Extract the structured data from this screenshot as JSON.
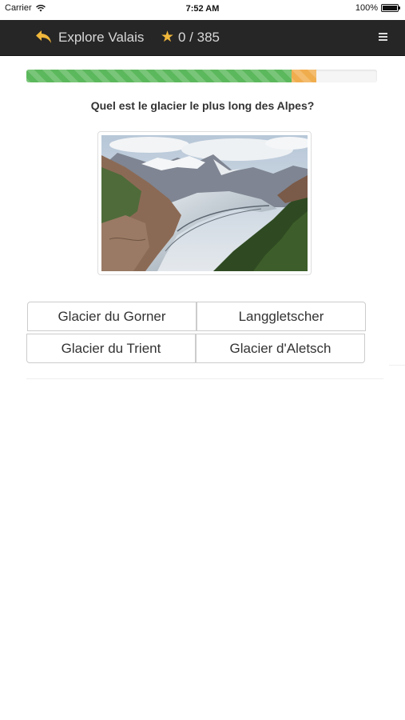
{
  "status_bar": {
    "carrier": "Carrier",
    "time": "7:52 AM",
    "battery": "100%"
  },
  "nav": {
    "back_icon": "reply-arrow-icon",
    "title": "Explore Valais",
    "star_icon": "star-icon",
    "score": "0 / 385",
    "menu_icon": "hamburger-menu-icon"
  },
  "progress": {
    "correct_fraction": 0.756,
    "wrong_fraction": 0.071,
    "colors": {
      "correct": "#5cb85c",
      "wrong": "#f0ad4e"
    }
  },
  "quiz": {
    "question": "Quel est le glacier le plus long des Alpes?",
    "image_alt": "glacier-photo",
    "answers": [
      "Glacier du Gorner",
      "Langgletscher",
      "Glacier du Trient",
      "Glacier d'Aletsch"
    ]
  },
  "colors": {
    "navbar": "#262626",
    "accent": "#f0b73b"
  }
}
